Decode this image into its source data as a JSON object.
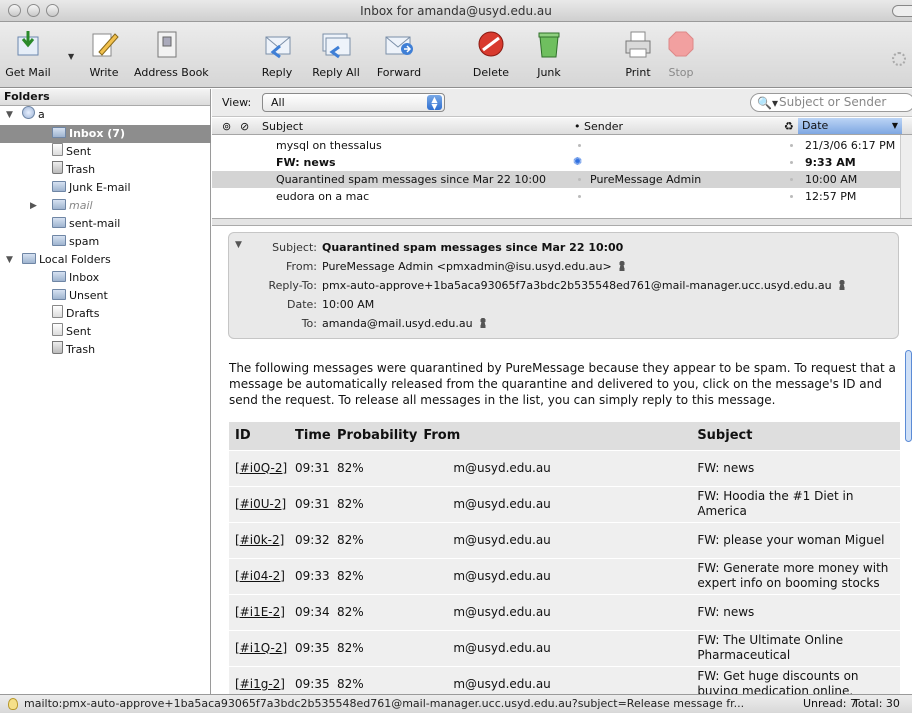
{
  "window": {
    "title": "Inbox for amanda@usyd.edu.au"
  },
  "toolbar": {
    "get_mail": "Get Mail",
    "write": "Write",
    "address_book": "Address Book",
    "reply": "Reply",
    "reply_all": "Reply All",
    "forward": "Forward",
    "delete": "Delete",
    "junk": "Junk",
    "print": "Print",
    "stop": "Stop"
  },
  "folders": {
    "header": "Folders",
    "account": "a",
    "inbox": "Inbox (7)",
    "sent": "Sent",
    "trash": "Trash",
    "junk": "Junk E-mail",
    "mail": "mail",
    "sent_mail": "sent-mail",
    "spam": "spam",
    "local": "Local Folders",
    "local_inbox": "Inbox",
    "local_unsent": "Unsent",
    "local_drafts": "Drafts",
    "local_sent": "Sent",
    "local_trash": "Trash"
  },
  "viewbar": {
    "label": "View:",
    "value": "All",
    "search_placeholder": "Subject or Sender"
  },
  "list": {
    "col_subject": "Subject",
    "col_sender": "Sender",
    "col_date": "Date",
    "rows": [
      {
        "subject": "mysql on thessalus",
        "sender": "",
        "date": "21/3/06 6:17 PM"
      },
      {
        "subject": "FW: news",
        "sender": "",
        "date": "9:33 AM"
      },
      {
        "subject": "Quarantined spam messages since Mar 22 10:00",
        "sender": "PureMessage Admin",
        "date": "10:00 AM"
      },
      {
        "subject": "eudora on a mac",
        "sender": "",
        "date": "12:57 PM"
      }
    ]
  },
  "header_pane": {
    "subject_key": "Subject:",
    "subject": "Quarantined spam messages since Mar 22 10:00",
    "from_key": "From:",
    "from": "PureMessage Admin <pmxadmin@isu.usyd.edu.au>",
    "replyto_key": "Reply-To:",
    "replyto": "pmx-auto-approve+1ba5aca93065f7a3bdc2b535548ed761@mail-manager.ucc.usyd.edu.au",
    "date_key": "Date:",
    "date": "10:00 AM",
    "to_key": "To:",
    "to": "amanda@mail.usyd.edu.au"
  },
  "body": {
    "intro": "The following messages were quarantined by PureMessage because they appear to be spam. To request that a message be automatically released from the quarantine and delivered to you, click on the message's ID and send the request. To release all messages in the list, you can simply reply to this message."
  },
  "qtable": {
    "headers": {
      "id": "ID",
      "time": "Time",
      "prob": "Probability",
      "from": "From",
      "subject": "Subject"
    },
    "rows": [
      {
        "id": "[#i0Q-2]",
        "time": "09:31",
        "prob": "82%",
        "from": "m@usyd.edu.au",
        "subject": "FW: news"
      },
      {
        "id": "[#i0U-2]",
        "time": "09:31",
        "prob": "82%",
        "from": "m@usyd.edu.au",
        "subject": "FW: Hoodia the #1 Diet in America"
      },
      {
        "id": "[#i0k-2]",
        "time": "09:32",
        "prob": "82%",
        "from": "m@usyd.edu.au",
        "subject": "FW: please your woman Miguel"
      },
      {
        "id": "[#i04-2]",
        "time": "09:33",
        "prob": "82%",
        "from": "m@usyd.edu.au",
        "subject": "FW: Generate more money with expert info on booming stocks"
      },
      {
        "id": "[#i1E-2]",
        "time": "09:34",
        "prob": "82%",
        "from": "m@usyd.edu.au",
        "subject": "FW: news"
      },
      {
        "id": "[#i1Q-2]",
        "time": "09:35",
        "prob": "82%",
        "from": "m@usyd.edu.au",
        "subject": "FW: The Ultimate Online Pharmaceutical"
      },
      {
        "id": "[#i1g-2]",
        "time": "09:35",
        "prob": "82%",
        "from": "m@usyd.edu.au",
        "subject": "FW: Get huge discounts on buying medication online."
      }
    ]
  },
  "status": {
    "url": "mailto:pmx-auto-approve+1ba5aca93065f7a3bdc2b535548ed761@mail-manager.ucc.usyd.edu.au?subject=Release message fr...",
    "unread": "Unread: 7",
    "total": "Total: 30"
  }
}
